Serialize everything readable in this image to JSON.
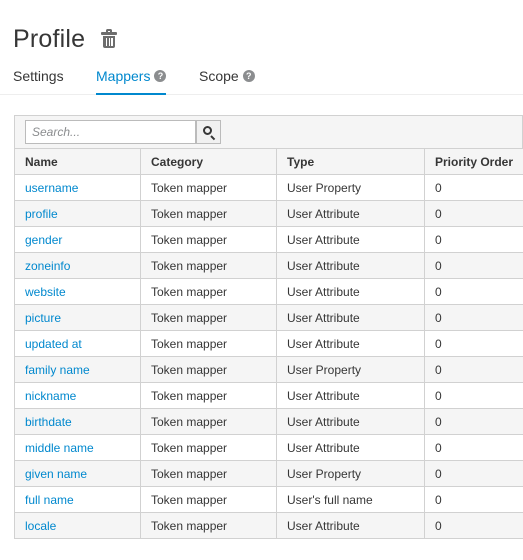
{
  "page": {
    "title": "Profile",
    "delete_icon": "trash-icon"
  },
  "tabs": [
    {
      "label": "Settings",
      "active": false,
      "help": false
    },
    {
      "label": "Mappers",
      "active": true,
      "help": true
    },
    {
      "label": "Scope",
      "active": false,
      "help": true
    }
  ],
  "toolbar": {
    "search_placeholder": "Search...",
    "search_icon": "search-icon"
  },
  "table": {
    "columns": [
      "Name",
      "Category",
      "Type",
      "Priority Order"
    ],
    "rows": [
      {
        "name": "username",
        "category": "Token mapper",
        "type": "User Property",
        "priority": "0"
      },
      {
        "name": "profile",
        "category": "Token mapper",
        "type": "User Attribute",
        "priority": "0"
      },
      {
        "name": "gender",
        "category": "Token mapper",
        "type": "User Attribute",
        "priority": "0"
      },
      {
        "name": "zoneinfo",
        "category": "Token mapper",
        "type": "User Attribute",
        "priority": "0"
      },
      {
        "name": "website",
        "category": "Token mapper",
        "type": "User Attribute",
        "priority": "0"
      },
      {
        "name": "picture",
        "category": "Token mapper",
        "type": "User Attribute",
        "priority": "0"
      },
      {
        "name": "updated at",
        "category": "Token mapper",
        "type": "User Attribute",
        "priority": "0"
      },
      {
        "name": "family name",
        "category": "Token mapper",
        "type": "User Property",
        "priority": "0"
      },
      {
        "name": "nickname",
        "category": "Token mapper",
        "type": "User Attribute",
        "priority": "0"
      },
      {
        "name": "birthdate",
        "category": "Token mapper",
        "type": "User Attribute",
        "priority": "0"
      },
      {
        "name": "middle name",
        "category": "Token mapper",
        "type": "User Attribute",
        "priority": "0"
      },
      {
        "name": "given name",
        "category": "Token mapper",
        "type": "User Property",
        "priority": "0"
      },
      {
        "name": "full name",
        "category": "Token mapper",
        "type": "User's full name",
        "priority": "0"
      },
      {
        "name": "locale",
        "category": "Token mapper",
        "type": "User Attribute",
        "priority": "0"
      }
    ]
  },
  "colors": {
    "link": "#0088ce",
    "text": "#363636",
    "stripe": "#f5f5f5",
    "border": "#d1d1d1"
  }
}
